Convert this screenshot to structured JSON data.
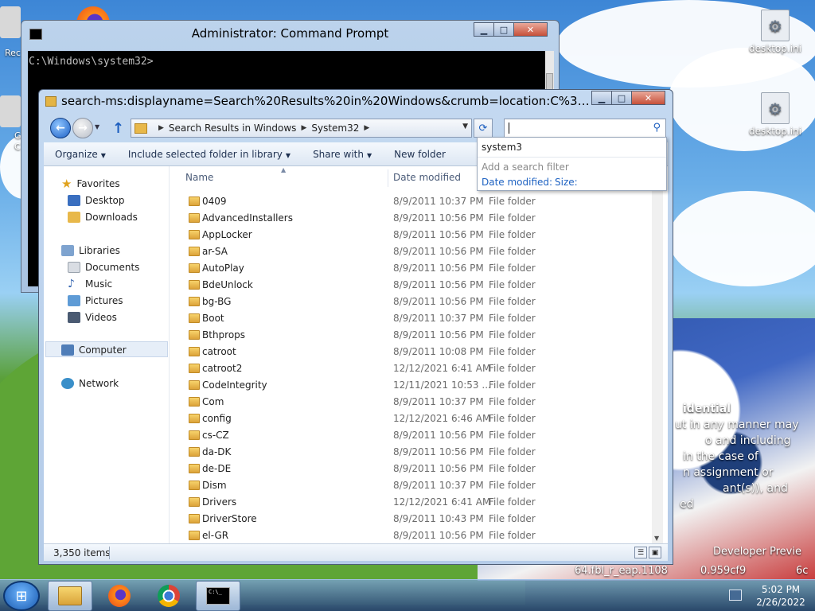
{
  "desktop": {
    "icons": [
      {
        "label": "desktop.ini"
      },
      {
        "label": "desktop.ini"
      }
    ],
    "left_partial_labels": [
      "Rec",
      "G",
      "C"
    ],
    "confidential_lines": [
      "idential",
      "ut in any manner may",
      "o and including",
      "in the case of",
      "n assignment or",
      "ant(s)), and",
      "ed"
    ],
    "build_lines": [
      "Developer Previe",
      "64.fbl_r_eap.1108",
      "0.959cf9",
      "6c"
    ]
  },
  "cmd": {
    "title": "Administrator: Command Prompt",
    "prompt": "C:\\Windows\\system32>"
  },
  "explorer": {
    "title": "search-ms:displayname=Search%20Results%20in%20Windows&crumb=location:C%3A%5CWindo...",
    "breadcrumbs": [
      "Search Results in Windows",
      "System32"
    ],
    "search_value": "",
    "toolbar": [
      {
        "label": "Organize",
        "has_arrow": true
      },
      {
        "label": "Include selected folder in library",
        "has_arrow": true
      },
      {
        "label": "Share with",
        "has_arrow": true
      },
      {
        "label": "New folder",
        "has_arrow": false
      }
    ],
    "nav": {
      "favorites": "Favorites",
      "desktop": "Desktop",
      "downloads": "Downloads",
      "libraries": "Libraries",
      "documents": "Documents",
      "music": "Music",
      "pictures": "Pictures",
      "videos": "Videos",
      "computer": "Computer",
      "network": "Network"
    },
    "columns": {
      "name": "Name",
      "date": "Date modified"
    },
    "rows": [
      {
        "name": "0409",
        "date": "8/9/2011 10:37 PM",
        "type": "File folder"
      },
      {
        "name": "AdvancedInstallers",
        "date": "8/9/2011 10:56 PM",
        "type": "File folder"
      },
      {
        "name": "AppLocker",
        "date": "8/9/2011 10:56 PM",
        "type": "File folder"
      },
      {
        "name": "ar-SA",
        "date": "8/9/2011 10:56 PM",
        "type": "File folder"
      },
      {
        "name": "AutoPlay",
        "date": "8/9/2011 10:56 PM",
        "type": "File folder"
      },
      {
        "name": "BdeUnlock",
        "date": "8/9/2011 10:56 PM",
        "type": "File folder"
      },
      {
        "name": "bg-BG",
        "date": "8/9/2011 10:56 PM",
        "type": "File folder"
      },
      {
        "name": "Boot",
        "date": "8/9/2011 10:37 PM",
        "type": "File folder"
      },
      {
        "name": "Bthprops",
        "date": "8/9/2011 10:56 PM",
        "type": "File folder"
      },
      {
        "name": "catroot",
        "date": "8/9/2011 10:08 PM",
        "type": "File folder"
      },
      {
        "name": "catroot2",
        "date": "12/12/2021 6:41 AM",
        "type": "File folder"
      },
      {
        "name": "CodeIntegrity",
        "date": "12/11/2021 10:53 ...",
        "type": "File folder"
      },
      {
        "name": "Com",
        "date": "8/9/2011 10:37 PM",
        "type": "File folder"
      },
      {
        "name": "config",
        "date": "12/12/2021 6:46 AM",
        "type": "File folder"
      },
      {
        "name": "cs-CZ",
        "date": "8/9/2011 10:56 PM",
        "type": "File folder"
      },
      {
        "name": "da-DK",
        "date": "8/9/2011 10:56 PM",
        "type": "File folder"
      },
      {
        "name": "de-DE",
        "date": "8/9/2011 10:56 PM",
        "type": "File folder"
      },
      {
        "name": "Dism",
        "date": "8/9/2011 10:37 PM",
        "type": "File folder"
      },
      {
        "name": "Drivers",
        "date": "12/12/2021 6:41 AM",
        "type": "File folder"
      },
      {
        "name": "DriverStore",
        "date": "8/9/2011 10:43 PM",
        "type": "File folder"
      },
      {
        "name": "el-GR",
        "date": "8/9/2011 10:56 PM",
        "type": "File folder"
      }
    ],
    "status": {
      "item_count": "3,350 items"
    },
    "search_dropdown": {
      "suggestion": "system3",
      "add_filter": "Add a search filter",
      "filter_date": "Date modified:",
      "filter_size": "Size:"
    }
  },
  "taskbar": {
    "time": "5:02 PM",
    "date": "2/26/2022"
  }
}
